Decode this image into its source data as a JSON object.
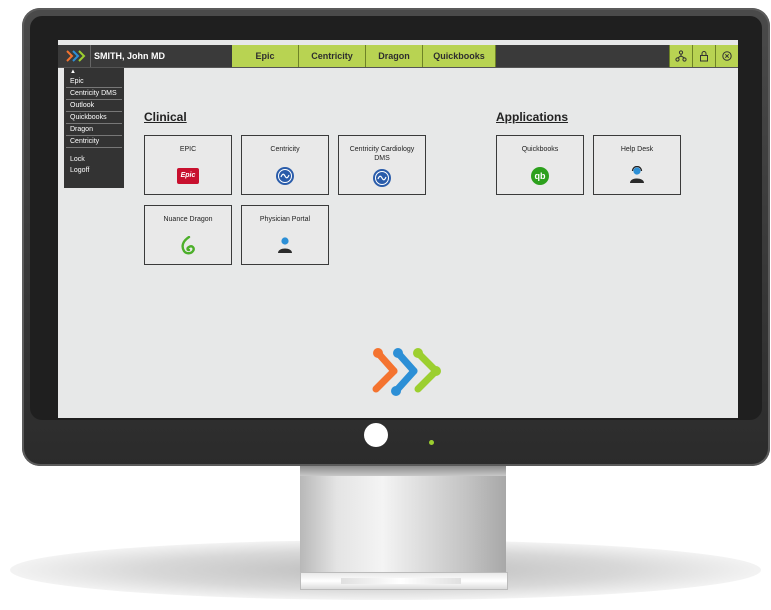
{
  "app": {
    "user": "SMITH, John MD"
  },
  "tabs": [
    {
      "label": "Epic"
    },
    {
      "label": "Centricity"
    },
    {
      "label": "Dragon"
    },
    {
      "label": "Quickbooks"
    }
  ],
  "menu": {
    "items": [
      "Epic",
      "Centricity DMS",
      "Outlook",
      "Quickbooks",
      "Dragon",
      "Centricity"
    ],
    "lock": "Lock",
    "logoff": "Logoff"
  },
  "sections": {
    "clinical": "Clinical",
    "applications": "Applications"
  },
  "clinical_tiles": [
    {
      "label": "EPIC",
      "icon": "epic-logo"
    },
    {
      "label": "Centricity",
      "icon": "ge-logo"
    },
    {
      "label": "Centricity Cardiology DMS",
      "icon": "ge-logo"
    },
    {
      "label": "Nuance Dragon",
      "icon": "dragon-logo"
    },
    {
      "label": "Physician Portal",
      "icon": "portal-person-icon"
    }
  ],
  "application_tiles": [
    {
      "label": "Quickbooks",
      "icon": "quickbooks-logo"
    },
    {
      "label": "Help Desk",
      "icon": "helpdesk-person-icon"
    }
  ],
  "icons": {
    "epic_text": "Epic",
    "qb_text": "qb"
  },
  "colors": {
    "accent_green": "#b8d352",
    "topbar": "#3a3a3a",
    "epic_red": "#c8102e",
    "ge_blue": "#2a5caa",
    "logo_orange": "#f4732f",
    "logo_blue": "#2c8fd6",
    "logo_green": "#9ccf2f"
  }
}
